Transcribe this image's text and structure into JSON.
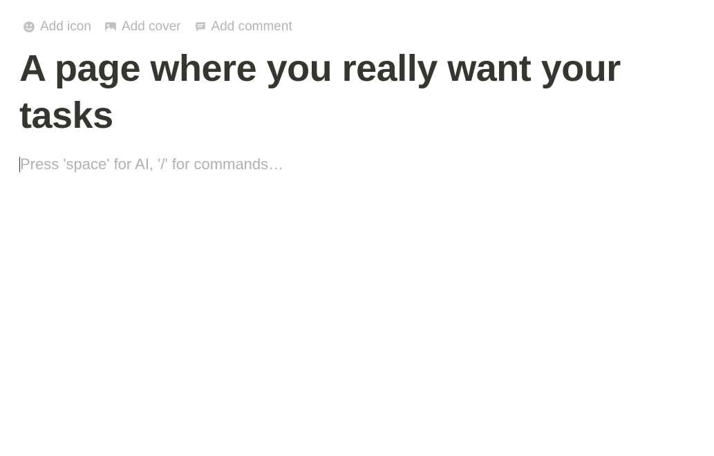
{
  "toolbar": {
    "add_icon_label": "Add icon",
    "add_cover_label": "Add cover",
    "add_comment_label": "Add comment"
  },
  "page": {
    "title": "A page where you really want your tasks"
  },
  "editor": {
    "placeholder": "Press 'space' for AI, '/' for commands…"
  }
}
